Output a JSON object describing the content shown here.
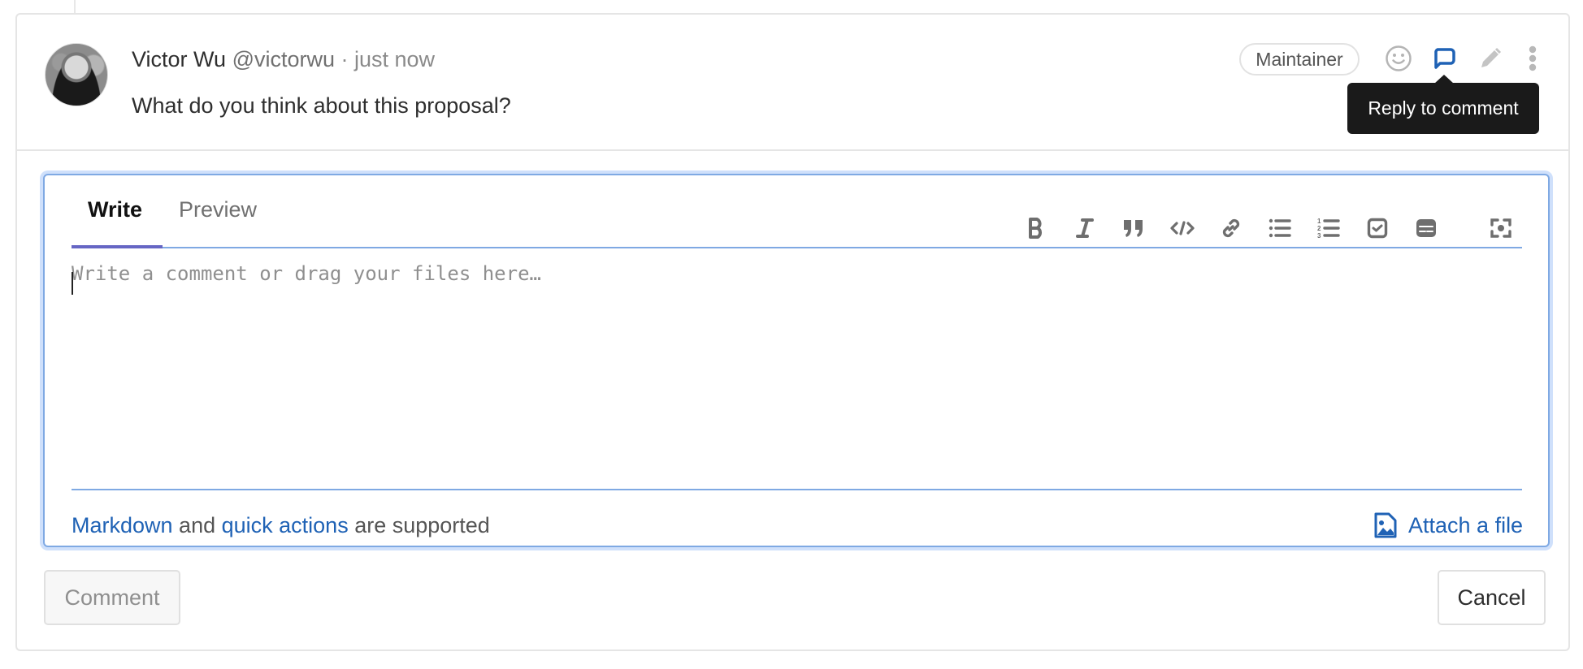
{
  "note": {
    "author_name": "Victor Wu",
    "author_handle": "@victorwu",
    "separator": " · ",
    "time": "just now",
    "body": "What do you think about this proposal?",
    "role_badge": "Maintainer",
    "actions": [
      {
        "name": "add-reaction",
        "icon": "smiley-icon"
      },
      {
        "name": "reply",
        "icon": "comment-bubble-icon",
        "active": true
      },
      {
        "name": "edit",
        "icon": "pencil-icon"
      },
      {
        "name": "more-actions",
        "icon": "kebab-icon"
      }
    ],
    "tooltip": "Reply to comment"
  },
  "editor": {
    "tabs": [
      {
        "label": "Write",
        "active": true
      },
      {
        "label": "Preview",
        "active": false
      }
    ],
    "toolbar": [
      {
        "name": "bold",
        "icon": "bold-icon"
      },
      {
        "name": "italic",
        "icon": "italic-icon"
      },
      {
        "name": "quote",
        "icon": "quote-icon"
      },
      {
        "name": "code",
        "icon": "code-icon"
      },
      {
        "name": "link",
        "icon": "link-icon"
      },
      {
        "name": "bullet-list",
        "icon": "bullet-list-icon"
      },
      {
        "name": "numbered-list",
        "icon": "numbered-list-icon"
      },
      {
        "name": "task-list",
        "icon": "task-list-icon"
      },
      {
        "name": "table",
        "icon": "table-icon"
      },
      {
        "name": "fullscreen",
        "icon": "fullscreen-icon"
      }
    ],
    "placeholder": "Write a comment or drag your files here…",
    "value": "",
    "footer": {
      "markdown_link": "Markdown",
      "and": " and ",
      "quick_actions_link": "quick actions",
      "suffix": " are supported"
    },
    "attach_label": "Attach a file"
  },
  "buttons": {
    "comment": "Comment",
    "cancel": "Cancel"
  },
  "colors": {
    "accent": "#1f62b5",
    "focus_border": "#7fa9e3",
    "tab_active": "#6666c4",
    "tooltip_bg": "#1a1a1a"
  }
}
